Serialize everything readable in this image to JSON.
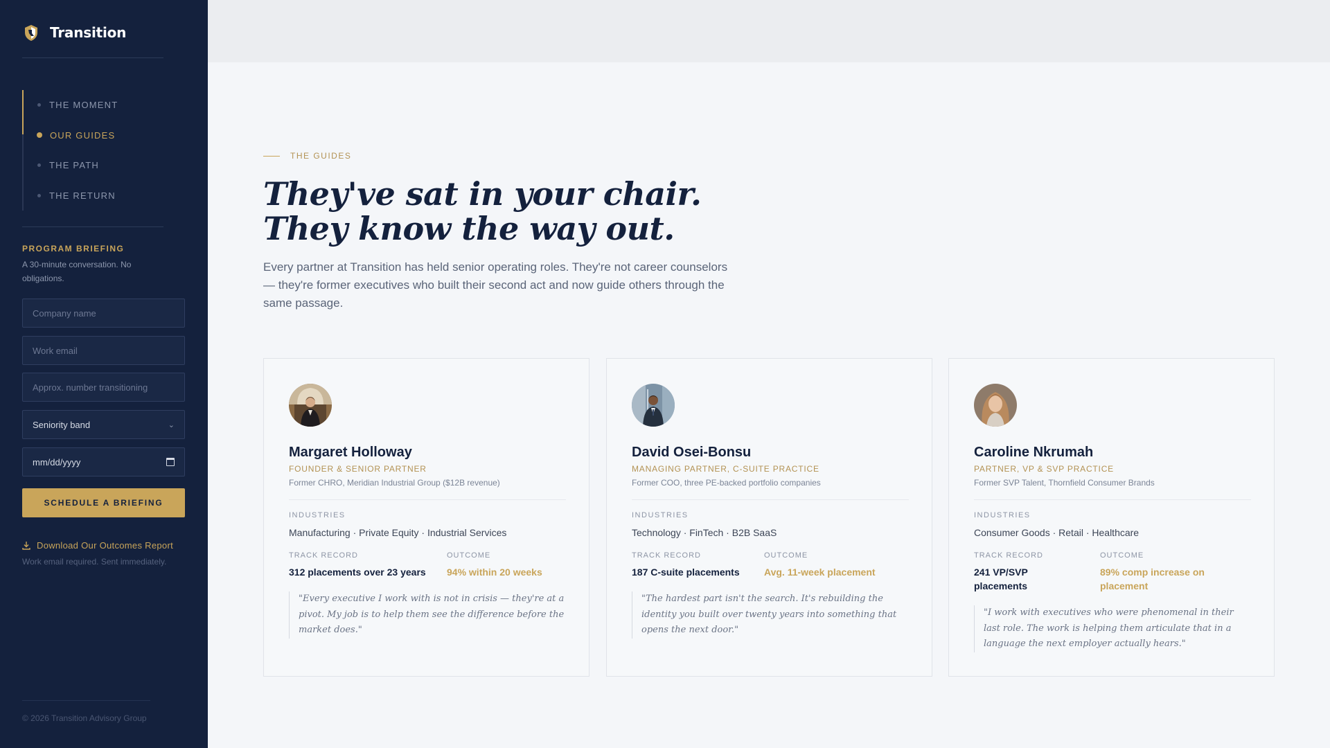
{
  "brand": {
    "name": "Transition"
  },
  "nav": {
    "items": [
      {
        "label": "THE MOMENT"
      },
      {
        "label": "OUR GUIDES"
      },
      {
        "label": "THE PATH"
      },
      {
        "label": "THE RETURN"
      }
    ],
    "active": "OUR GUIDES"
  },
  "briefing": {
    "title": "PROGRAM BRIEFING",
    "subtitle": "A 30-minute conversation. No obligations.",
    "company_placeholder": "Company name",
    "email_placeholder": "Work email",
    "number_placeholder": "Approx. number transitioning",
    "seniority_value": "Seniority band",
    "date_value": "mm/dd/yyyy",
    "cta_label": "SCHEDULE A BRIEFING",
    "download_label": "Download Our Outcomes Report",
    "download_note": "Work email required. Sent immediately."
  },
  "footer": {
    "copyright": "© 2026 Transition Advisory Group"
  },
  "section": {
    "eyebrow": "THE GUIDES",
    "headline_line1": "They've sat in your chair.",
    "headline_line2": "They know the way out.",
    "intro": "Every partner at Transition has held senior operating roles. They're not career counselors — they're former executives who built their second act and now guide others through the same passage."
  },
  "labels": {
    "industries": "INDUSTRIES",
    "track_record": "TRACK RECORD",
    "outcome": "OUTCOME"
  },
  "guides": [
    {
      "name": "Margaret Holloway",
      "role": "FOUNDER & SENIOR PARTNER",
      "former": "Former CHRO, Meridian Industrial Group ($12B revenue)",
      "industries": "Manufacturing · Private Equity · Industrial Services",
      "track_record": "312 placements over 23 years",
      "outcome": "94% within 20 weeks",
      "quote": "\"Every executive I work with is not in crisis — they're at a pivot. My job is to help them see the difference before the market does.\""
    },
    {
      "name": "David Osei-Bonsu",
      "role": "MANAGING PARTNER, C-SUITE PRACTICE",
      "former": "Former COO, three PE-backed portfolio companies",
      "industries": "Technology · FinTech · B2B SaaS",
      "track_record": "187 C-suite placements",
      "outcome": "Avg. 11-week placement",
      "quote": "\"The hardest part isn't the search. It's rebuilding the identity you built over twenty years into something that opens the next door.\""
    },
    {
      "name": "Caroline Nkrumah",
      "role": "PARTNER, VP & SVP PRACTICE",
      "former": "Former SVP Talent, Thornfield Consumer Brands",
      "industries": "Consumer Goods · Retail · Healthcare",
      "track_record": "241 VP/SVP placements",
      "outcome": "89% comp increase on placement",
      "quote": "\"I work with executives who were phenomenal in their last role. The work is helping them articulate that in a language the next employer actually hears.\""
    }
  ],
  "colors": {
    "sidebar": "#14213d",
    "accent": "#c9a55a",
    "background": "#f4f6f9"
  },
  "icons": {
    "brand": "shield-logo-icon",
    "download": "download-icon",
    "chevron": "chevron-down-icon",
    "calendar": "calendar-icon"
  }
}
